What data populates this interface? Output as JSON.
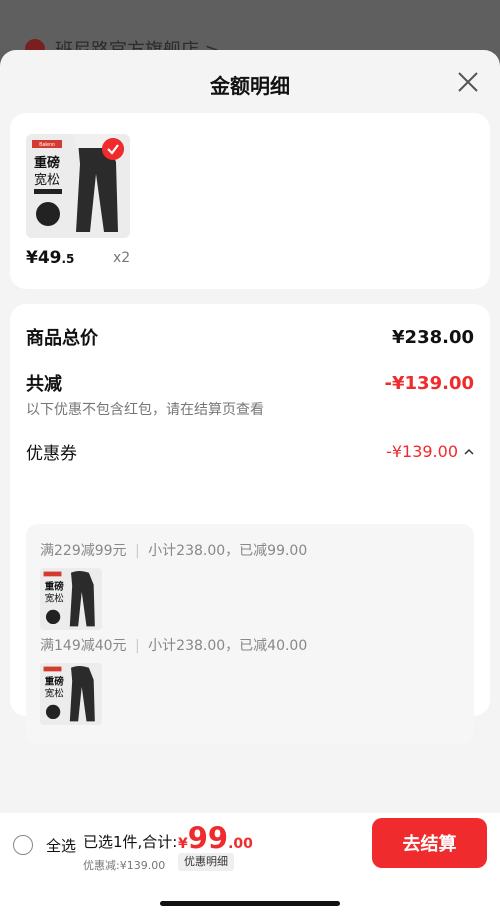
{
  "background": {
    "store_name": "班尼路官方旗舰店 >"
  },
  "sheet": {
    "title": "金额明细"
  },
  "product": {
    "price_main": "¥49",
    "price_dec": ".5",
    "qty": "x2",
    "image": {
      "title": "重磅",
      "subtitle": "宽松",
      "brand": "Baleno"
    }
  },
  "summary": {
    "total_label": "商品总价",
    "total_value": "¥238.00",
    "reduce_label": "共减",
    "reduce_value": "-¥139.00",
    "note": "以下优惠不包含红包，请在结算页查看",
    "coupon_label": "优惠券",
    "coupon_value": "-¥139.00"
  },
  "coupons": [
    {
      "rule": "满229减99元",
      "detail": "小计238.00，已减99.00"
    },
    {
      "rule": "满149减40元",
      "detail": "小计238.00，已减40.00"
    }
  ],
  "bottom": {
    "select_all": "全选",
    "selected_info": "已选1件,合计:",
    "total_sym": "¥",
    "total_int": "99",
    "total_dec": ".00",
    "discount_text": "优惠减:¥139.00",
    "detail_chip": "优惠明细",
    "checkout": "去结算"
  },
  "colors": {
    "accent": "#ef2b2d"
  }
}
